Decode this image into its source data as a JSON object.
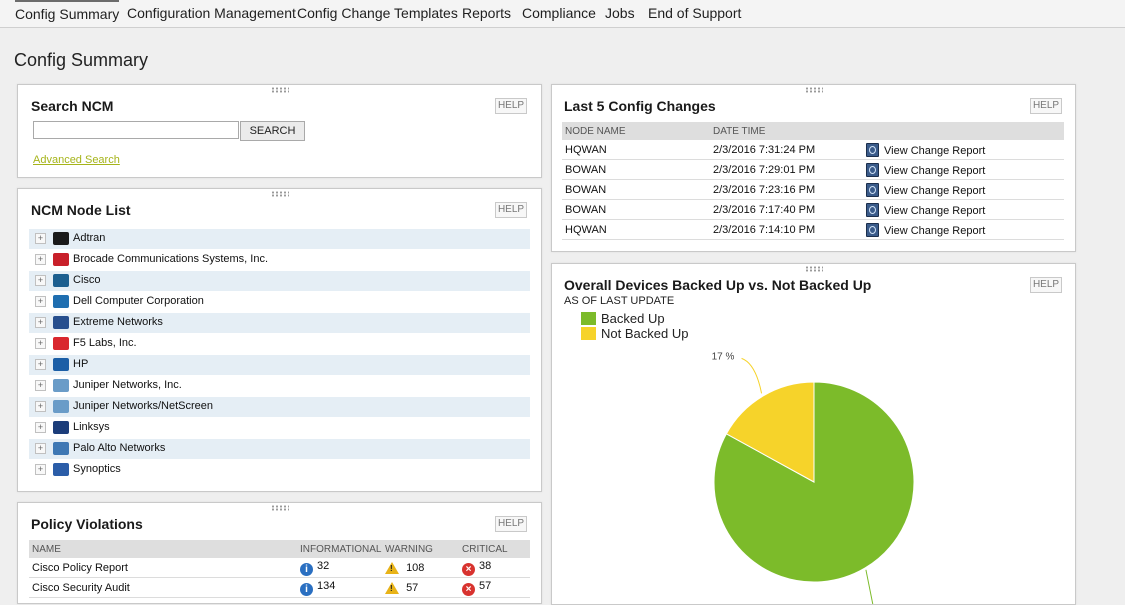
{
  "nav": {
    "tabs": [
      {
        "label": "Config Summary"
      },
      {
        "label": "Configuration Management"
      },
      {
        "label": "Config Change Templates"
      },
      {
        "label": "Reports"
      },
      {
        "label": "Compliance"
      },
      {
        "label": "Jobs"
      },
      {
        "label": "End of Support"
      }
    ]
  },
  "page": {
    "title": "Config Summary"
  },
  "help_label": "HELP",
  "search": {
    "title": "Search NCM",
    "input_value": "",
    "button_label": "SEARCH",
    "advanced_link": "Advanced Search"
  },
  "node_list": {
    "title": "NCM Node List",
    "items": [
      {
        "label": "Adtran",
        "icon": "adtran-logo-icon",
        "color": "#1a1a1a"
      },
      {
        "label": "Brocade Communications Systems, Inc.",
        "icon": "brocade-logo-icon",
        "color": "#c8202a"
      },
      {
        "label": "Cisco",
        "icon": "cisco-logo-icon",
        "color": "#1c5f8f"
      },
      {
        "label": "Dell Computer Corporation",
        "icon": "dell-logo-icon",
        "color": "#1f6eb0"
      },
      {
        "label": "Extreme Networks",
        "icon": "extreme-logo-icon",
        "color": "#274f8e"
      },
      {
        "label": "F5 Labs, Inc.",
        "icon": "f5-logo-icon",
        "color": "#d9272e"
      },
      {
        "label": "HP",
        "icon": "hp-logo-icon",
        "color": "#1b5ea6"
      },
      {
        "label": "Juniper Networks, Inc.",
        "icon": "juniper-logo-icon",
        "color": "#6a9cc8"
      },
      {
        "label": "Juniper Networks/NetScreen",
        "icon": "netscreen-logo-icon",
        "color": "#6a9cc8"
      },
      {
        "label": "Linksys",
        "icon": "linksys-logo-icon",
        "color": "#1c3d7a"
      },
      {
        "label": "Palo Alto Networks",
        "icon": "paloalto-logo-icon",
        "color": "#3f78b4"
      },
      {
        "label": "Synoptics",
        "icon": "synoptics-logo-icon",
        "color": "#2b5da8"
      }
    ]
  },
  "policy": {
    "title": "Policy Violations",
    "headers": {
      "name": "NAME",
      "info": "INFORMATIONAL",
      "warn": "WARNING",
      "crit": "CRITICAL"
    },
    "rows": [
      {
        "name": "Cisco Policy Report",
        "info": "32",
        "warn": "108",
        "crit": "38"
      },
      {
        "name": "Cisco Security Audit",
        "info": "134",
        "warn": "57",
        "crit": "57"
      }
    ]
  },
  "changes": {
    "title": "Last 5 Config Changes",
    "headers": {
      "node": "NODE NAME",
      "date": "DATE TIME"
    },
    "link_label": "View Change Report",
    "rows": [
      {
        "node": "HQWAN",
        "date": "2/3/2016 7:31:24 PM"
      },
      {
        "node": "BOWAN",
        "date": "2/3/2016 7:29:01 PM"
      },
      {
        "node": "BOWAN",
        "date": "2/3/2016 7:23:16 PM"
      },
      {
        "node": "BOWAN",
        "date": "2/3/2016 7:17:40 PM"
      },
      {
        "node": "HQWAN",
        "date": "2/3/2016 7:14:10 PM"
      }
    ]
  },
  "backup": {
    "title": "Overall Devices Backed Up vs. Not Backed Up",
    "subtitle": "AS OF LAST UPDATE",
    "legend": [
      {
        "label": "Backed Up",
        "color": "#7cbb2a"
      },
      {
        "label": "Not Backed Up",
        "color": "#f6d32a"
      }
    ],
    "slice_label": "17 %"
  },
  "chart_data": {
    "type": "pie",
    "title": "Overall Devices Backed Up vs. Not Backed Up",
    "subtitle": "AS OF LAST UPDATE",
    "labels": [
      "Backed Up",
      "Not Backed Up"
    ],
    "values": [
      83,
      17
    ],
    "colors": [
      "#7cbb2a",
      "#f6d32a"
    ],
    "legend_position": "top-left"
  }
}
